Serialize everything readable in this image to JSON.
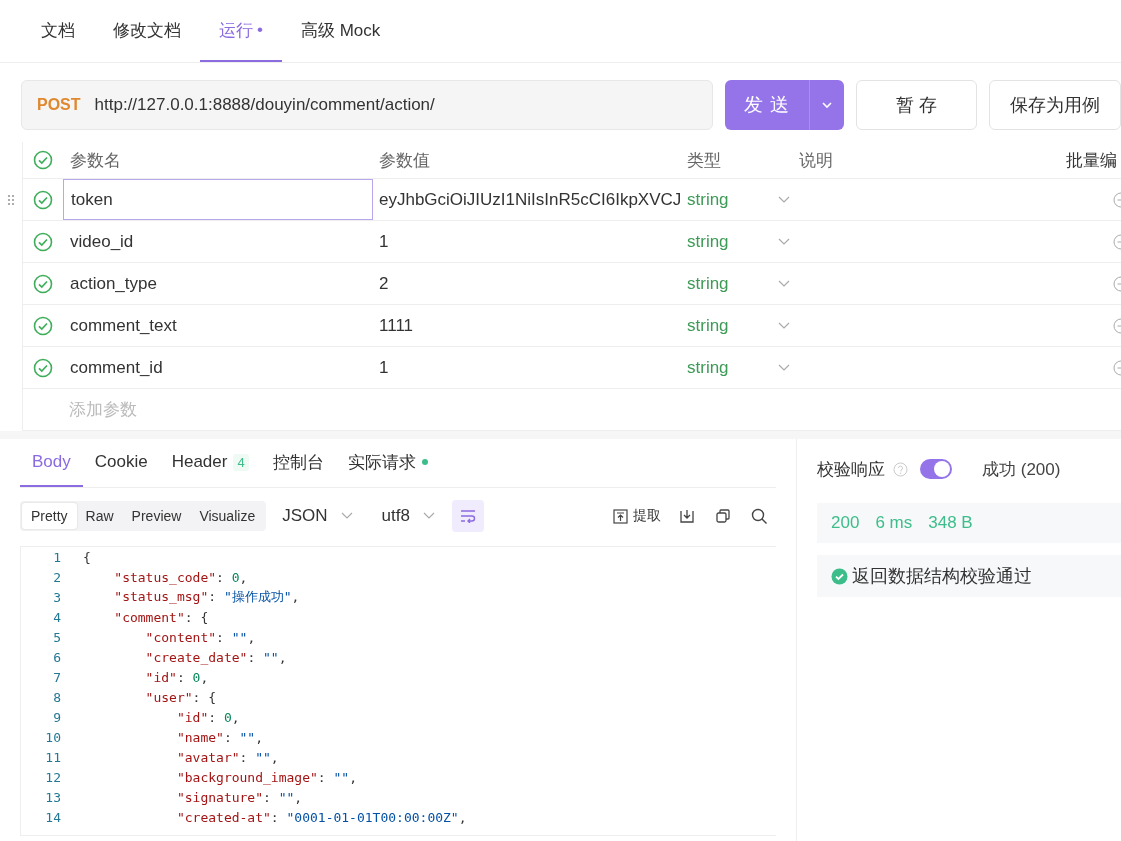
{
  "tabs": [
    {
      "label": "文档",
      "selected": false
    },
    {
      "label": "修改文档",
      "selected": false
    },
    {
      "label": "运行",
      "selected": true,
      "marker": "•"
    },
    {
      "label": "高级 Mock",
      "selected": false
    }
  ],
  "request": {
    "method": "POST",
    "url": "http://127.0.0.1:8888/douyin/comment/action/",
    "send_button": "发 送",
    "save_draft_button": "暂 存",
    "save_case_button": "保存为用例"
  },
  "params": {
    "all_checked": true,
    "columns": [
      "参数名",
      "参数值",
      "类型",
      "说明"
    ],
    "bulk_edit": "批量编",
    "rows": [
      {
        "checked": true,
        "name": "token",
        "value": "eyJhbGciOiJIUzI1NiIsInR5cCI6IkpXVCJ",
        "type": "string",
        "focused": true
      },
      {
        "checked": true,
        "name": "video_id",
        "value": "1",
        "type": "string",
        "focused": false
      },
      {
        "checked": true,
        "name": "action_type",
        "value": "2",
        "type": "string",
        "focused": false
      },
      {
        "checked": true,
        "name": "comment_text",
        "value": "1111",
        "type": "string",
        "focused": false
      },
      {
        "checked": true,
        "name": "comment_id",
        "value": "1",
        "type": "string",
        "focused": false
      }
    ],
    "add_placeholder": "添加参数"
  },
  "response": {
    "tabs": [
      {
        "label": "Body",
        "selected": true,
        "dot": false
      },
      {
        "label": "Cookie",
        "selected": false,
        "dot": false
      },
      {
        "label": "Header",
        "selected": false,
        "badge": "4",
        "dot": false
      },
      {
        "label": "控制台",
        "selected": false,
        "dot": false
      },
      {
        "label": "实际请求",
        "selected": false,
        "dot": true
      }
    ],
    "view_modes": [
      {
        "label": "Pretty",
        "selected": true
      },
      {
        "label": "Raw",
        "selected": false
      },
      {
        "label": "Preview",
        "selected": false
      },
      {
        "label": "Visualize",
        "selected": false
      }
    ],
    "format": "JSON",
    "encoding": "utf8",
    "wrap_on": true,
    "extract": "提取",
    "code_lines": [
      {
        "num": "1",
        "tokens": [
          {
            "kind": "punct",
            "text": "{"
          }
        ]
      },
      {
        "num": "2",
        "tokens": [
          {
            "kind": "key",
            "text": "    \"status_code\""
          },
          {
            "kind": "punct",
            "text": ": "
          },
          {
            "kind": "num",
            "text": "0"
          },
          {
            "kind": "punct",
            "text": ","
          }
        ]
      },
      {
        "num": "3",
        "tokens": [
          {
            "kind": "key",
            "text": "    \"status_msg\""
          },
          {
            "kind": "punct",
            "text": ": "
          },
          {
            "kind": "str",
            "text": "\"操作成功\""
          },
          {
            "kind": "punct",
            "text": ","
          }
        ]
      },
      {
        "num": "4",
        "tokens": [
          {
            "kind": "key",
            "text": "    \"comment\""
          },
          {
            "kind": "punct",
            "text": ": {"
          }
        ]
      },
      {
        "num": "5",
        "tokens": [
          {
            "kind": "key",
            "text": "        \"content\""
          },
          {
            "kind": "punct",
            "text": ": "
          },
          {
            "kind": "str",
            "text": "\"\""
          },
          {
            "kind": "punct",
            "text": ","
          }
        ]
      },
      {
        "num": "6",
        "tokens": [
          {
            "kind": "key",
            "text": "        \"create_date\""
          },
          {
            "kind": "punct",
            "text": ": "
          },
          {
            "kind": "str",
            "text": "\"\""
          },
          {
            "kind": "punct",
            "text": ","
          }
        ]
      },
      {
        "num": "7",
        "tokens": [
          {
            "kind": "key",
            "text": "        \"id\""
          },
          {
            "kind": "punct",
            "text": ": "
          },
          {
            "kind": "num",
            "text": "0"
          },
          {
            "kind": "punct",
            "text": ","
          }
        ]
      },
      {
        "num": "8",
        "tokens": [
          {
            "kind": "key",
            "text": "        \"user\""
          },
          {
            "kind": "punct",
            "text": ": {"
          }
        ]
      },
      {
        "num": "9",
        "tokens": [
          {
            "kind": "key",
            "text": "            \"id\""
          },
          {
            "kind": "punct",
            "text": ": "
          },
          {
            "kind": "num",
            "text": "0"
          },
          {
            "kind": "punct",
            "text": ","
          }
        ]
      },
      {
        "num": "10",
        "tokens": [
          {
            "kind": "key",
            "text": "            \"name\""
          },
          {
            "kind": "punct",
            "text": ": "
          },
          {
            "kind": "str",
            "text": "\"\""
          },
          {
            "kind": "punct",
            "text": ","
          }
        ]
      },
      {
        "num": "11",
        "tokens": [
          {
            "kind": "key",
            "text": "            \"avatar\""
          },
          {
            "kind": "punct",
            "text": ": "
          },
          {
            "kind": "str",
            "text": "\"\""
          },
          {
            "kind": "punct",
            "text": ","
          }
        ]
      },
      {
        "num": "12",
        "tokens": [
          {
            "kind": "key",
            "text": "            \"background_image\""
          },
          {
            "kind": "punct",
            "text": ": "
          },
          {
            "kind": "str",
            "text": "\"\""
          },
          {
            "kind": "punct",
            "text": ","
          }
        ]
      },
      {
        "num": "13",
        "tokens": [
          {
            "kind": "key",
            "text": "            \"signature\""
          },
          {
            "kind": "punct",
            "text": ": "
          },
          {
            "kind": "str",
            "text": "\"\""
          },
          {
            "kind": "punct",
            "text": ","
          }
        ]
      },
      {
        "num": "14",
        "tokens": [
          {
            "kind": "key",
            "text": "            \"created-at\""
          },
          {
            "kind": "punct",
            "text": ": "
          },
          {
            "kind": "str",
            "text": "\"0001-01-01T00:00:00Z\""
          },
          {
            "kind": "punct",
            "text": ","
          }
        ]
      }
    ]
  },
  "validation": {
    "label": "校验响应",
    "enabled": true,
    "result": "成功 (200)",
    "status": "200",
    "time": "6 ms",
    "size": "348 B",
    "passed": true,
    "message": "返回数据结构校验通过"
  }
}
